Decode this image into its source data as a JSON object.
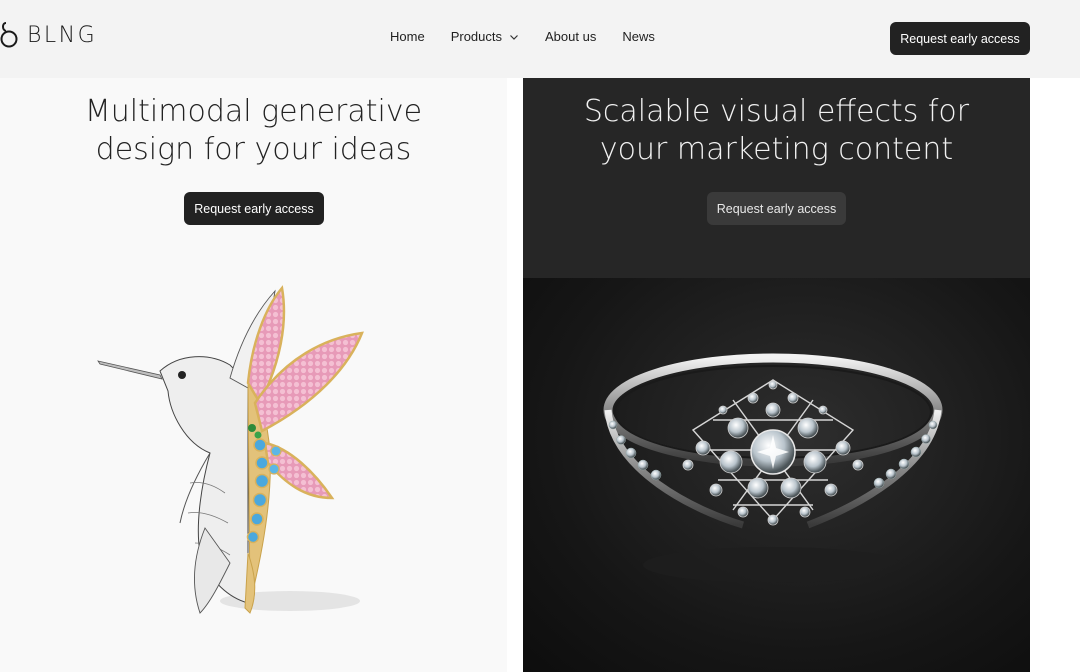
{
  "brand": {
    "name": "BLNG",
    "logo_icon": "blng-logo-icon"
  },
  "nav": {
    "items": [
      {
        "label": "Home"
      },
      {
        "label": "Products",
        "icon": "chevron-down-icon"
      },
      {
        "label": "About us"
      },
      {
        "label": "News"
      }
    ]
  },
  "header": {
    "cta_label": "Request early access"
  },
  "panels": [
    {
      "title_line1": "Multimodal generative",
      "title_line2": "design for your ideas",
      "cta_label": "Request early access",
      "image": "hummingbird-jewelry-image"
    },
    {
      "title_line1": "Scalable visual effects for",
      "title_line2": "your marketing content",
      "cta_label": "Request early access",
      "image": "diamond-ring-image"
    }
  ],
  "colors": {
    "header_bg": "#f3f3f3",
    "dark_button": "#222222",
    "dark_panel": "#262626",
    "light_panel": "#f9f9f9"
  }
}
